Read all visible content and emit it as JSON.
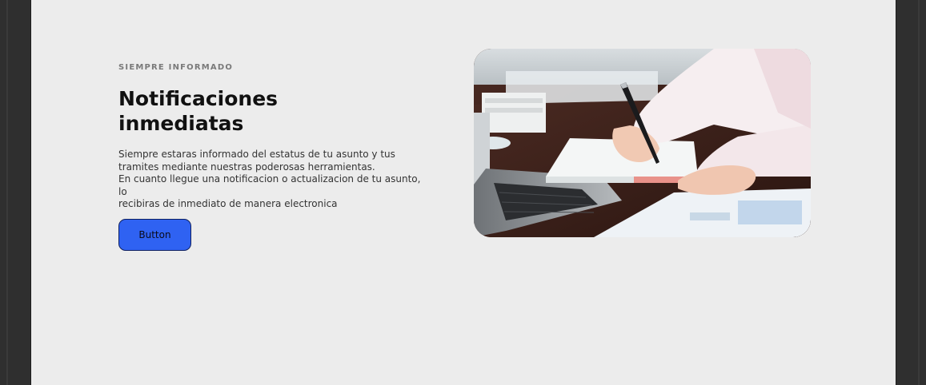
{
  "hero": {
    "eyebrow": "SIEMPRE INFORMADO",
    "title_line1": "Notificaciones",
    "title_line2": "inmediatas",
    "body_line1": "Siempre estaras informado del estatus de tu asunto y tus",
    "body_line2": "tramites mediante nuestras poderosas herramientas.",
    "body_line3": "En cuanto llegue una notificacion o actualizacion de tu asunto, lo",
    "body_line4": "recibiras de inmediato de manera electronica",
    "button_label": "Button",
    "button_color": "#2f62f2"
  },
  "image": {
    "icon": "person-writing-photo"
  }
}
